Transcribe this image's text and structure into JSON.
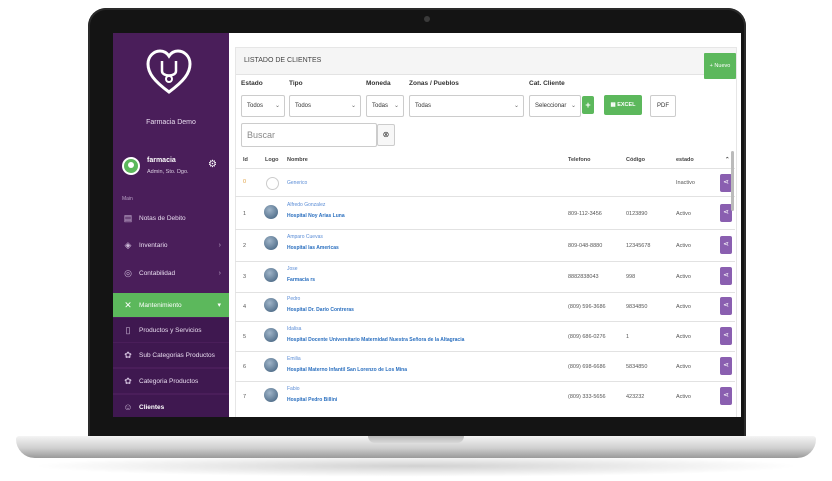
{
  "sidebar": {
    "brand": "Farmacia Demo",
    "user": {
      "name": "farmacia",
      "role": "Admin, Sto. Dgo."
    },
    "section": "Main",
    "items": [
      {
        "label": "Notas de Debito",
        "icon": "document-icon"
      },
      {
        "label": "Inventario",
        "icon": "box-icon"
      },
      {
        "label": "Contabilidad",
        "icon": "calculator-icon"
      },
      {
        "label": "Mantenimiento",
        "icon": "wrench-icon"
      },
      {
        "label": "Productos y Servicios",
        "icon": "file-icon"
      },
      {
        "label": "Sub Categorias Productos",
        "icon": "tag-icon"
      },
      {
        "label": "Categoria Productos",
        "icon": "tag-icon"
      },
      {
        "label": "Clientes",
        "icon": "users-icon"
      }
    ]
  },
  "panel": {
    "title": "LISTADO DE CLIENTES",
    "new_label": "+ Nuevo"
  },
  "filters": {
    "estado": {
      "label": "Estado",
      "value": "Todos"
    },
    "tipo": {
      "label": "Tipo",
      "value": "Todos"
    },
    "moneda": {
      "label": "Moneda",
      "value": "Todas"
    },
    "zonas": {
      "label": "Zonas / Pueblos",
      "value": "Todas"
    },
    "cat": {
      "label": "Cat. Cliente",
      "value": "Seleccionar"
    },
    "plus": "+",
    "excel": "EXCEL",
    "pdf": "PDF"
  },
  "search": {
    "placeholder": "Buscar"
  },
  "table": {
    "headers": {
      "id": "Id",
      "logo": "Logo",
      "nombre": "Nombre",
      "telefono": "Telefono",
      "codigo": "Código",
      "estado": "estado"
    },
    "rows": [
      {
        "id": "0",
        "top": "",
        "name": "Generico",
        "tel": "",
        "code": "",
        "status": "Inactivo"
      },
      {
        "id": "1",
        "top": "Alfredo Gonzalez",
        "name": "Hospital Noy Arias Luna",
        "tel": "809-112-3456",
        "code": "0123890",
        "status": "Activo"
      },
      {
        "id": "2",
        "top": "Amparo Cuevas",
        "name": "Hospital las Americas",
        "tel": "809-048-8880",
        "code": "12345678",
        "status": "Activo"
      },
      {
        "id": "3",
        "top": "Jose",
        "name": "Farmacia rs",
        "tel": "8882838043",
        "code": "998",
        "status": "Activo"
      },
      {
        "id": "4",
        "top": "Pedro",
        "name": "Hospital Dr. Darío Contreras",
        "tel": "(809) 596-3686",
        "code": "9834850",
        "status": "Activo"
      },
      {
        "id": "5",
        "top": "Idalisa",
        "name": "Hospital Docente Universitario Maternidad Nuestra Señora de la Altagracia",
        "tel": "(809) 686-0276",
        "code": "1",
        "status": "Activo"
      },
      {
        "id": "6",
        "top": "Emilia",
        "name": "Hospital Materno Infantil San Lorenzo de Los Mina",
        "tel": "(809) 698-6686",
        "code": "5834850",
        "status": "Activo"
      },
      {
        "id": "7",
        "top": "Fabio",
        "name": "Hospital Pedro Billini",
        "tel": "(809) 333-5656",
        "code": "423232",
        "status": "Activo"
      }
    ]
  }
}
